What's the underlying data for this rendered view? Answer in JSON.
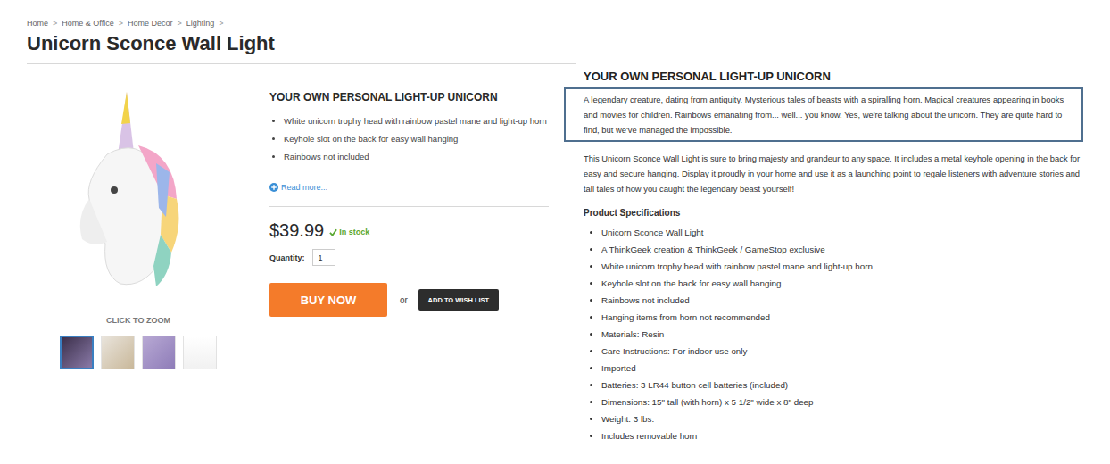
{
  "breadcrumb": {
    "items": [
      "Home",
      "Home & Office",
      "Home Decor",
      "Lighting"
    ],
    "separator": ">"
  },
  "title": "Unicorn Sconce Wall Light",
  "gallery": {
    "zoom_label": "CLICK TO ZOOM",
    "thumbnails": [
      {
        "selected": true
      },
      {
        "selected": false
      },
      {
        "selected": false
      },
      {
        "selected": false
      }
    ]
  },
  "summary": {
    "heading": "YOUR OWN PERSONAL LIGHT-UP UNICORN",
    "bullets": [
      "White unicorn trophy head with rainbow pastel mane and light-up horn",
      "Keyhole slot on the back for easy wall hanging",
      "Rainbows not included"
    ],
    "read_more": "Read more..."
  },
  "price": "$39.99",
  "stock": "In stock",
  "quantity": {
    "label": "Quantity:",
    "value": "1"
  },
  "buttons": {
    "buy": "BUY NOW",
    "or": "or",
    "wishlist": "ADD TO WISH LIST"
  },
  "details": {
    "heading": "YOUR OWN PERSONAL LIGHT-UP UNICORN",
    "paragraphs": [
      {
        "text": "A legendary creature, dating from antiquity. Mysterious tales of beasts with a spiralling horn. Magical creatures appearing in books and movies for children. Rainbows emanating from... well... you know. Yes, we're talking about the unicorn. They are quite hard to find, but we've managed the impossible.",
        "highlighted": true
      },
      {
        "text": "This Unicorn Sconce Wall Light is sure to bring majesty and grandeur to any space. It includes a metal keyhole opening in the back for easy and secure hanging. Display it proudly in your home and use it as a launching point to regale listeners with adventure stories and tall tales of how you caught the legendary beast yourself!",
        "highlighted": false
      }
    ],
    "spec_heading": "Product Specifications",
    "specs": [
      "Unicorn Sconce Wall Light",
      "A ThinkGeek creation & ThinkGeek / GameStop exclusive",
      "White unicorn trophy head with rainbow pastel mane and light-up horn",
      "Keyhole slot on the back for easy wall hanging",
      "Rainbows not included",
      "Hanging items from horn not recommended",
      "Materials: Resin",
      "Care Instructions: For indoor use only",
      "Imported",
      "Batteries: 3 LR44 button cell batteries (included)",
      "Dimensions: 15\" tall (with horn) x 5 1/2\" wide x 8\" deep",
      "Weight: 3 lbs.",
      "Includes removable horn"
    ]
  }
}
